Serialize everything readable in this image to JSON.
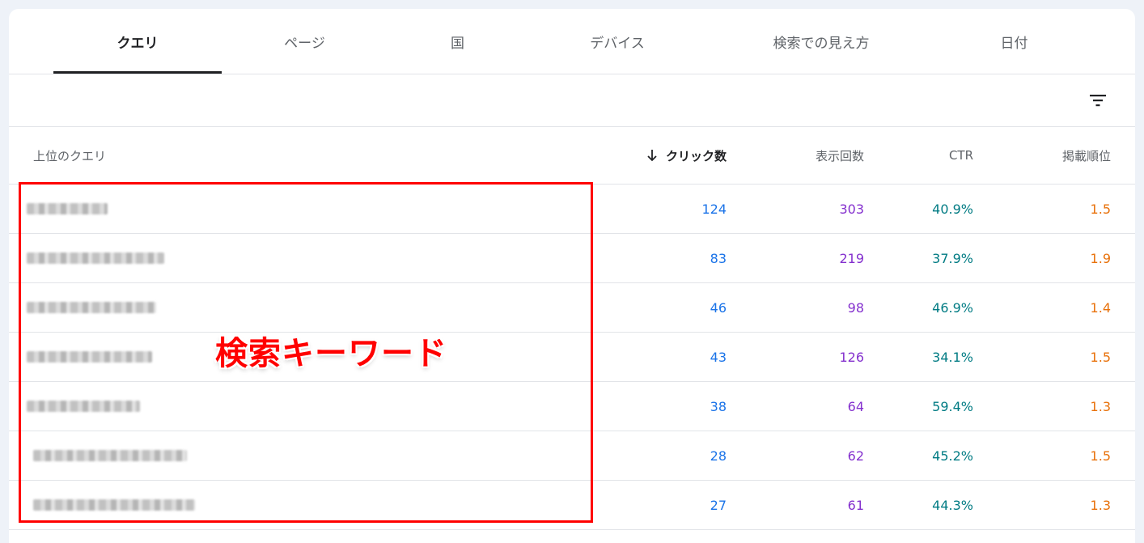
{
  "tabs": [
    {
      "label": "クエリ",
      "active": true
    },
    {
      "label": "ページ"
    },
    {
      "label": "国"
    },
    {
      "label": "デバイス"
    },
    {
      "label": "検索での見え方"
    },
    {
      "label": "日付"
    }
  ],
  "filter": {
    "icon": "filter-icon"
  },
  "table": {
    "headers": {
      "query": "上位のクエリ",
      "clicks": "クリック数",
      "impressions": "表示回数",
      "ctr": "CTR",
      "position": "掲載順位"
    },
    "sort_icon": "arrow-down-icon",
    "rows": [
      {
        "clicks": "124",
        "impressions": "303",
        "ctr": "40.9%",
        "position": "1.5"
      },
      {
        "clicks": "83",
        "impressions": "219",
        "ctr": "37.9%",
        "position": "1.9"
      },
      {
        "clicks": "46",
        "impressions": "98",
        "ctr": "46.9%",
        "position": "1.4"
      },
      {
        "clicks": "43",
        "impressions": "126",
        "ctr": "34.1%",
        "position": "1.5"
      },
      {
        "clicks": "38",
        "impressions": "64",
        "ctr": "59.4%",
        "position": "1.3"
      },
      {
        "clicks": "28",
        "impressions": "62",
        "ctr": "45.2%",
        "position": "1.5"
      },
      {
        "clicks": "27",
        "impressions": "61",
        "ctr": "44.3%",
        "position": "1.3"
      }
    ]
  },
  "annotation": {
    "label": "検索キーワード",
    "color": "#ff0000"
  },
  "colors": {
    "clicks": "#1a73e8",
    "impressions": "#8430ce",
    "ctr": "#007b83",
    "position": "#e8710a"
  }
}
